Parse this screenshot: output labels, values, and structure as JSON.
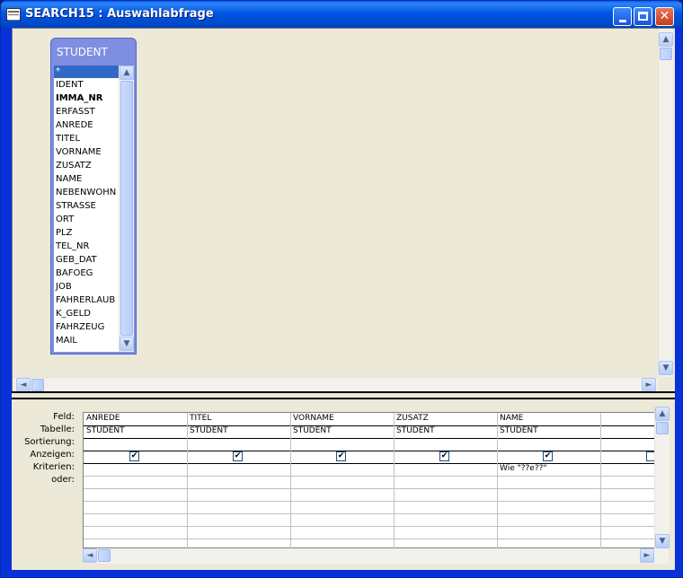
{
  "window": {
    "title": "SEARCH15 : Auswahlabfrage"
  },
  "table": {
    "name": "STUDENT",
    "fields": [
      "*",
      "IDENT",
      "IMMA_NR",
      "ERFASST",
      "ANREDE",
      "TITEL",
      "VORNAME",
      "ZUSATZ",
      "NAME",
      "NEBENWOHN",
      "STRASSE",
      "ORT",
      "PLZ",
      "TEL_NR",
      "GEB_DAT",
      "BAFOEG",
      "JOB",
      "FAHRERLAUB",
      "K_GELD",
      "FAHRZEUG",
      "MAIL"
    ],
    "selected_field": "*",
    "bold_field": "IMMA_NR"
  },
  "grid": {
    "row_labels": {
      "feld": "Feld:",
      "tabelle": "Tabelle:",
      "sortierung": "Sortierung:",
      "anzeigen": "Anzeigen:",
      "kriterien": "Kriterien:",
      "oder": "oder:"
    },
    "columns": [
      {
        "feld": "ANREDE",
        "tabelle": "STUDENT",
        "anzeigen": true,
        "kriterien": ""
      },
      {
        "feld": "TITEL",
        "tabelle": "STUDENT",
        "anzeigen": true,
        "kriterien": ""
      },
      {
        "feld": "VORNAME",
        "tabelle": "STUDENT",
        "anzeigen": true,
        "kriterien": ""
      },
      {
        "feld": "ZUSATZ",
        "tabelle": "STUDENT",
        "anzeigen": true,
        "kriterien": ""
      },
      {
        "feld": "NAME",
        "tabelle": "STUDENT",
        "anzeigen": true,
        "kriterien": "Wie \"??e??\""
      },
      {
        "feld": "",
        "tabelle": "",
        "anzeigen": false,
        "kriterien": ""
      }
    ]
  },
  "icons": {
    "scroll_up": "▲",
    "scroll_down": "▼",
    "scroll_left": "◄",
    "scroll_right": "►",
    "check": "✔"
  }
}
